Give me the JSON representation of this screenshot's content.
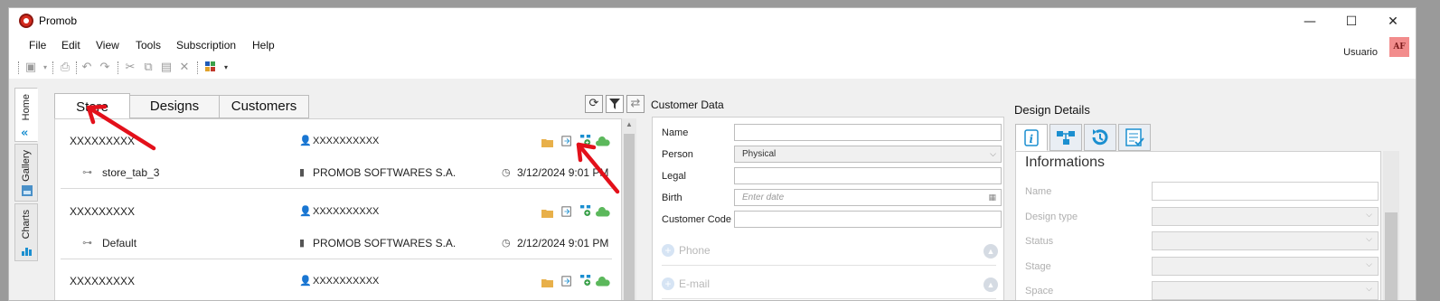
{
  "window": {
    "title": "Promob",
    "controls": {
      "minimize": "—",
      "maximize": "☐",
      "close": "✕"
    }
  },
  "menu": [
    "File",
    "Edit",
    "View",
    "Tools",
    "Subscription",
    "Help"
  ],
  "user": {
    "name": "Usuario",
    "badge": "AF"
  },
  "sidebar": {
    "tabs": [
      {
        "label": "Home",
        "icon": "home-arrows-icon"
      },
      {
        "label": "Gallery",
        "icon": "gallery-icon"
      },
      {
        "label": "Charts",
        "icon": "chart-icon"
      }
    ]
  },
  "store": {
    "tabs": [
      "Store",
      "Designs",
      "Customers"
    ],
    "active_tab": "Store",
    "buttons": [
      "refresh-icon",
      "filter-icon",
      "swap-icon"
    ],
    "entries": [
      {
        "name": "XXXXXXXXX",
        "person": "XXXXXXXXXX",
        "design": "store_tab_3",
        "company": "PROMOB SOFTWARES S.A.",
        "date": "3/12/2024 9:01 PM"
      },
      {
        "name": "XXXXXXXXX",
        "person": "XXXXXXXXXX",
        "design": "Default",
        "company": "PROMOB SOFTWARES S.A.",
        "date": "2/12/2024 9:01 PM"
      },
      {
        "name": "XXXXXXXXX",
        "person": "XXXXXXXXXX",
        "design": "",
        "company": "",
        "date": ""
      }
    ]
  },
  "customer": {
    "title": "Customer Data",
    "fields": {
      "name_label": "Name",
      "name_value": "",
      "person_label": "Person",
      "person_value": "Physical",
      "legal_label": "Legal",
      "legal_value": "",
      "birth_label": "Birth",
      "birth_placeholder": "Enter date",
      "code_label": "Customer Code",
      "code_value": ""
    },
    "sections": {
      "phone": "Phone",
      "email": "E-mail"
    }
  },
  "design": {
    "title": "Design Details",
    "tabs": [
      "info-icon",
      "hierarchy-icon",
      "history-icon",
      "checklist-icon"
    ],
    "section_title": "Informations",
    "fields": [
      "Name",
      "Design type",
      "Status",
      "Stage",
      "Space"
    ]
  },
  "colors": {
    "accent": "#1b8fd0",
    "annotation": "#e3101a",
    "badge": "#f28c8c",
    "cloud": "#5cb85c",
    "folder": "#e8b04a"
  }
}
